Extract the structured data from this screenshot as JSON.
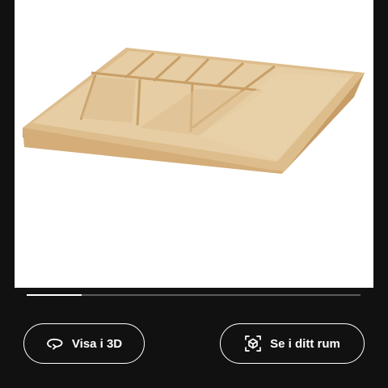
{
  "product_image": {
    "subject": "wooden-cutlery-tray",
    "background_color": "#ffffff"
  },
  "carousel": {
    "progress": 0.165,
    "track_color": "#5a5a5a",
    "fill_color": "#ffffff"
  },
  "actions": {
    "view_3d_label": "Visa i 3D",
    "view_3d_icon": "rotate-3d-icon",
    "room_label": "Se i ditt rum",
    "room_icon": "ar-view-icon"
  },
  "colors": {
    "background": "#111111",
    "button_border": "#ffffff",
    "button_text": "#ffffff"
  }
}
